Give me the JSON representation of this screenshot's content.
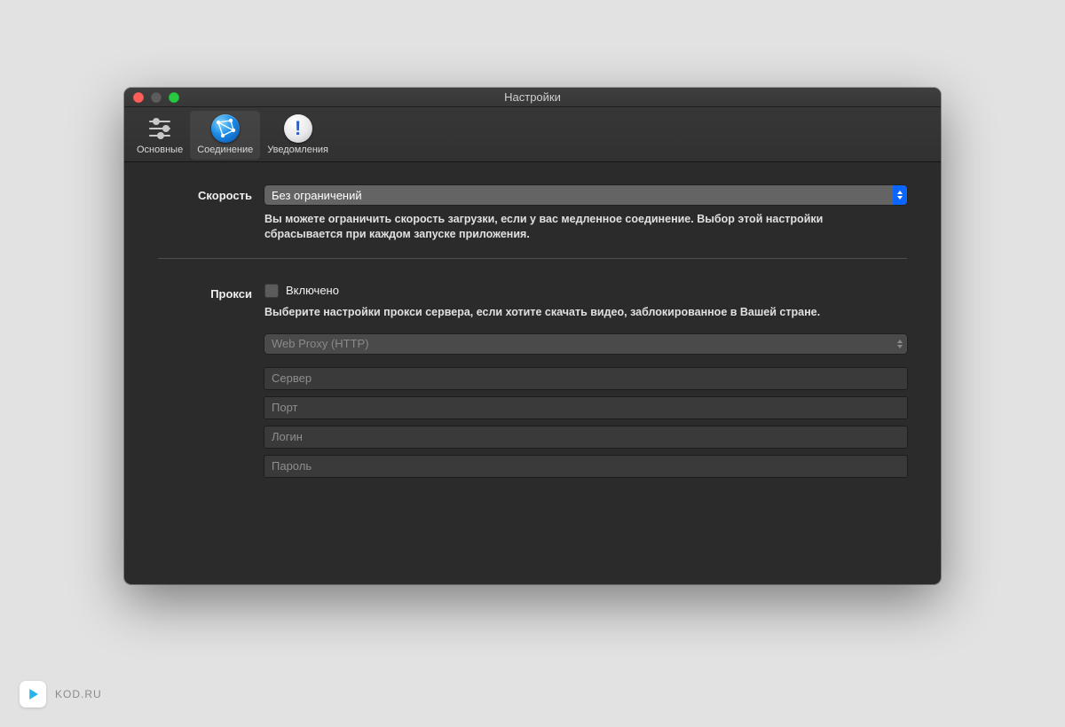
{
  "window": {
    "title": "Настройки"
  },
  "toolbar": {
    "items": [
      {
        "label": "Основные"
      },
      {
        "label": "Соединение"
      },
      {
        "label": "Уведомления"
      }
    ]
  },
  "speed": {
    "label": "Скорость",
    "selected": "Без ограничений",
    "hint": "Вы можете ограничить скорость загрузки, если у вас медленное соединение. Выбор этой настройки сбрасывается при каждом запуске приложения."
  },
  "proxy": {
    "label": "Прокси",
    "checkbox_label": "Включено",
    "hint": "Выберите настройки прокси сервера, если хотите скачать видео, заблокированное в Вашей стране.",
    "type_selected": "Web Proxy (HTTP)",
    "fields": {
      "server": "Сервер",
      "port": "Порт",
      "login": "Логин",
      "password": "Пароль"
    }
  },
  "watermark": {
    "text": "KOD.RU"
  }
}
